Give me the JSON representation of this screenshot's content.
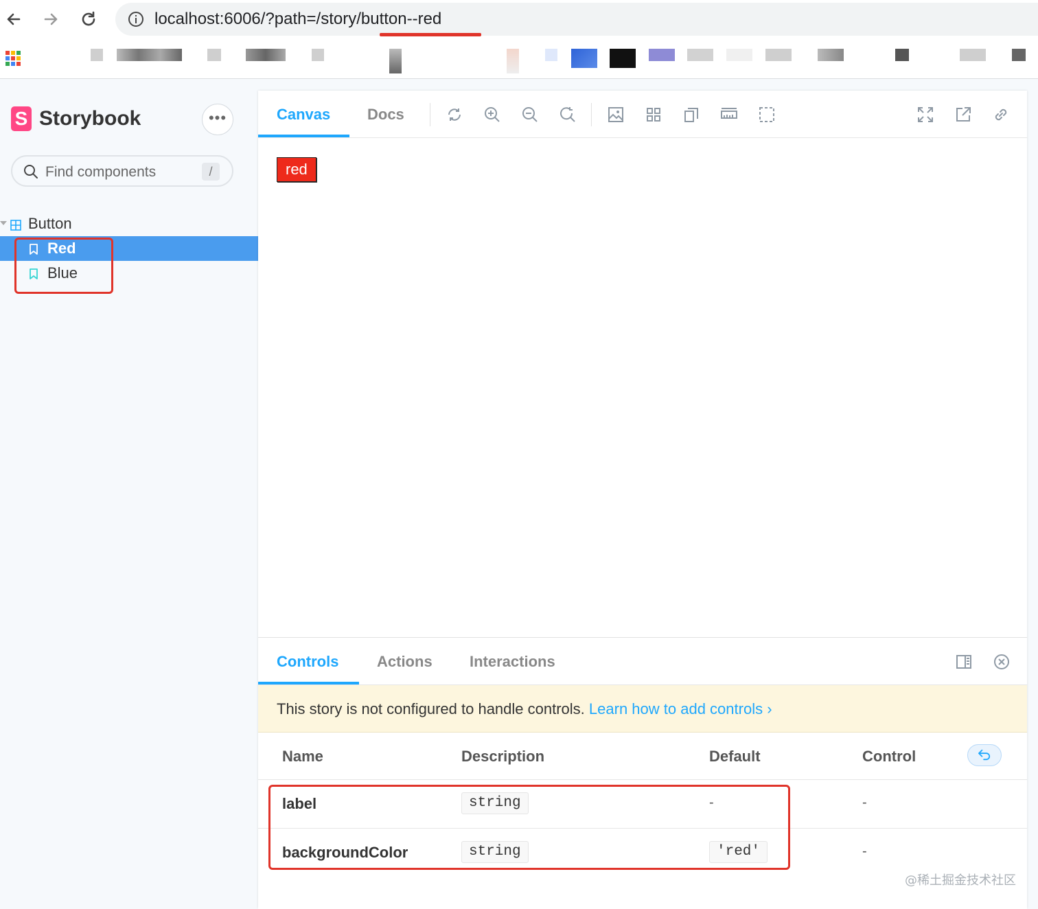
{
  "browser": {
    "url": "localhost:6006/?path=/story/button--red"
  },
  "sidebar": {
    "logo_letter": "S",
    "brand": "Storybook",
    "menu_glyph": "•••",
    "search_placeholder": "Find components",
    "search_shortcut": "/",
    "group": "Button",
    "stories": [
      {
        "label": "Red",
        "selected": true
      },
      {
        "label": "Blue",
        "selected": false
      }
    ]
  },
  "toolbar": {
    "tabs": [
      "Canvas",
      "Docs"
    ],
    "active_tab": "Canvas"
  },
  "canvas": {
    "button_label": "red",
    "button_color": "#ee2a1b"
  },
  "addons": {
    "tabs": [
      "Controls",
      "Actions",
      "Interactions"
    ],
    "active_tab": "Controls",
    "notice_text": "This story is not configured to handle controls.",
    "notice_link": "Learn how to add controls ›",
    "columns": [
      "Name",
      "Description",
      "Default",
      "Control"
    ],
    "rows": [
      {
        "name": "label",
        "description": "string",
        "default": "-",
        "control": "-"
      },
      {
        "name": "backgroundColor",
        "description": "string",
        "default": "'red'",
        "control": "-"
      }
    ]
  },
  "watermark": "@稀土掘金技术社区",
  "colors": {
    "accent": "#1ea7fd",
    "brand": "#ff4785",
    "highlight": "#e0342a",
    "selected_row": "#4a9cee"
  }
}
